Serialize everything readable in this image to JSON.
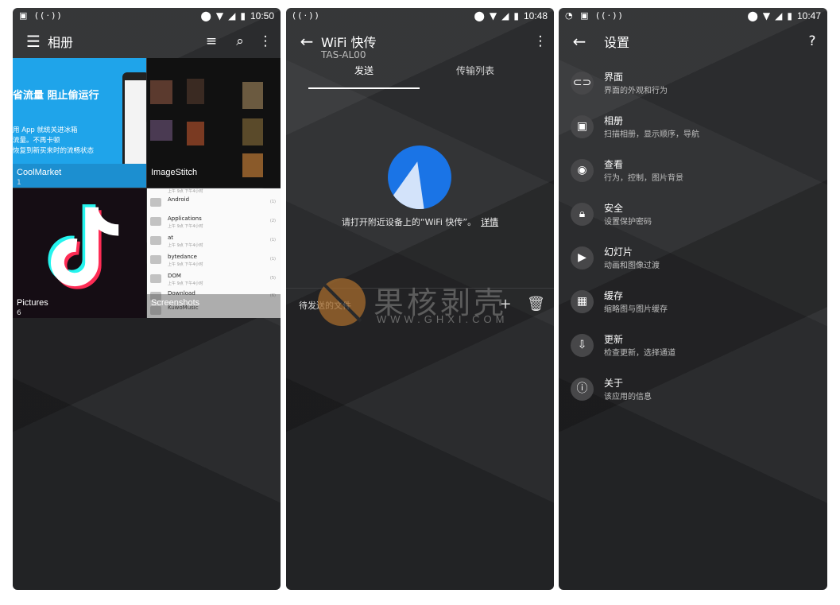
{
  "phone1": {
    "status": {
      "time": "10:50"
    },
    "appbar": {
      "title": "相册"
    },
    "albums": [
      {
        "name": "CoolMarket",
        "count": "1"
      },
      {
        "name": "ImageStitch",
        "count": ""
      },
      {
        "name": "Pictures",
        "count": "6"
      },
      {
        "name": "Screenshots",
        "count": ""
      }
    ],
    "coolmarket_thumb": {
      "headline": "省流量 阻止偷运行",
      "line1": "用 App 就统关进冰箱",
      "line2": "流量。不再卡顿",
      "line3": "恢复到新买来时的流畅状态"
    },
    "screenshot_thumb": {
      "rows": [
        {
          "name": "Android",
          "date": "上午 9点 下午4小时",
          "count": "(1)"
        },
        {
          "name": "Applications",
          "date": "上午 9点 下午4小时",
          "count": "(2)"
        },
        {
          "name": "at",
          "date": "上午 9点 下午4小时",
          "count": "(1)"
        },
        {
          "name": "bytedance",
          "date": "上午 9点 下午4小时",
          "count": "(1)"
        },
        {
          "name": "DOM",
          "date": "上午 9点 下午4小时",
          "count": "(5)"
        },
        {
          "name": "Download",
          "date": "",
          "count": "(6)"
        },
        {
          "name": "KuwoMusic",
          "date": "",
          "count": ""
        }
      ]
    }
  },
  "phone2": {
    "status": {
      "time": "10:48"
    },
    "appbar": {
      "title": "WiFi 快传",
      "subtitle": "TAS-AL00"
    },
    "tabs": [
      "发送",
      "传输列表"
    ],
    "prompt": "请打开附近设备上的“WiFi 快传”。",
    "prompt_link": "详情",
    "pending_label": "待发送的文件"
  },
  "phone3": {
    "status": {
      "time": "10:47"
    },
    "appbar": {
      "title": "设置"
    },
    "items": [
      {
        "icon": "toggle-icon",
        "title": "界面",
        "subtitle": "界面的外观和行为"
      },
      {
        "icon": "image-icon",
        "title": "相册",
        "subtitle": "扫描相册，显示顺序，导航"
      },
      {
        "icon": "eye-icon",
        "title": "查看",
        "subtitle": "行为，控制，图片背景"
      },
      {
        "icon": "lock-icon",
        "title": "安全",
        "subtitle": "设置保护密码"
      },
      {
        "icon": "slideshow-icon",
        "title": "幻灯片",
        "subtitle": "动画和图像过渡"
      },
      {
        "icon": "chip-icon",
        "title": "缓存",
        "subtitle": "缩略图与图片缓存"
      },
      {
        "icon": "update-icon",
        "title": "更新",
        "subtitle": "检查更新，选择通道"
      },
      {
        "icon": "info-icon",
        "title": "关于",
        "subtitle": "该应用的信息"
      }
    ]
  },
  "watermark": {
    "cn": "果核剥壳",
    "en": "WWW.GHXI.COM"
  },
  "colors": {
    "background": "#2b2c2e",
    "accent": "#1a74e6"
  }
}
